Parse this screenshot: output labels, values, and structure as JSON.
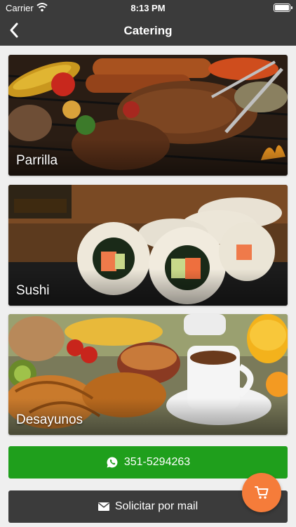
{
  "status_bar": {
    "carrier": "Carrier",
    "time": "8:13 PM"
  },
  "nav": {
    "title": "Catering"
  },
  "categories": [
    {
      "label": "Parrilla"
    },
    {
      "label": "Sushi"
    },
    {
      "label": "Desayunos"
    }
  ],
  "actions": {
    "whatsapp_label": "351-5294263",
    "mail_label": "Solicitar por mail"
  },
  "colors": {
    "nav": "#3b3b3b",
    "whatsapp": "#1f9f1c",
    "fab": "#f57c3a",
    "background": "#efefef"
  },
  "icons": {
    "back": "chevron-left-icon",
    "whatsapp": "whatsapp-icon",
    "mail": "envelope-icon",
    "fab": "cart-icon"
  }
}
